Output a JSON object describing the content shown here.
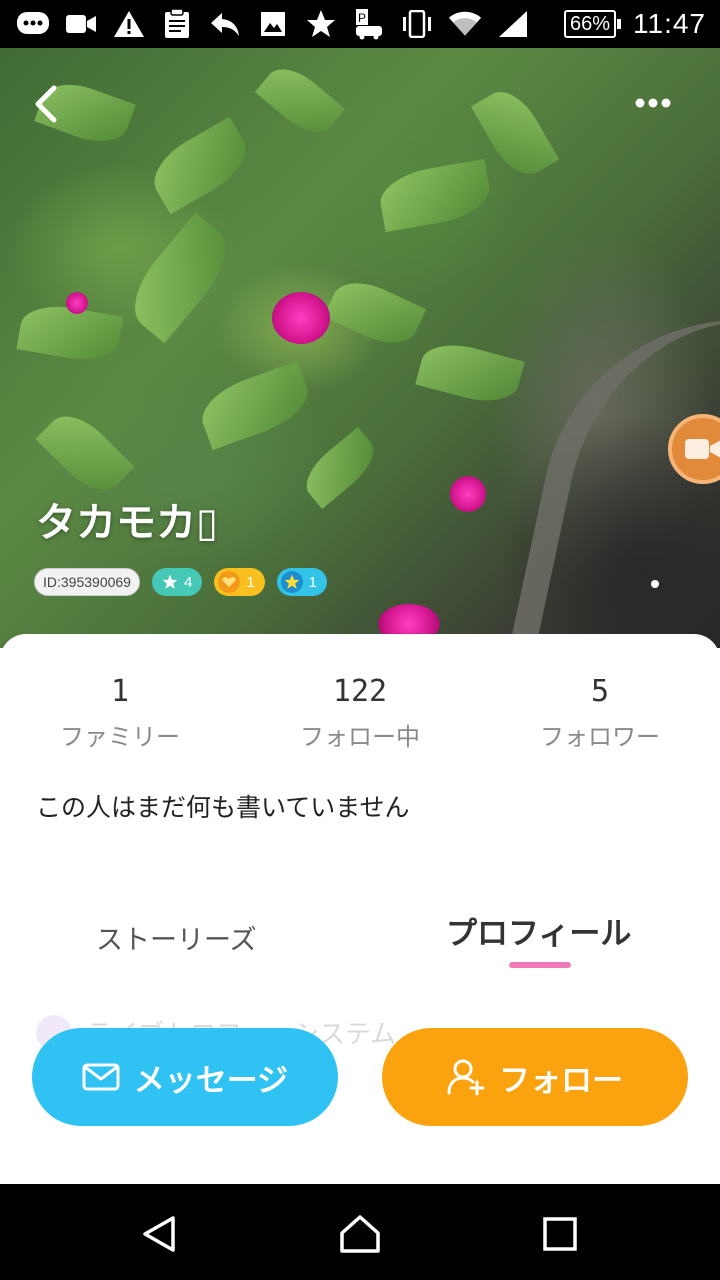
{
  "status_bar": {
    "icons": [
      "chat-bubble-icon",
      "video-camera-icon",
      "warning-icon",
      "clipboard-icon",
      "reply-icon",
      "image-icon",
      "star-icon",
      "parking-car-icon",
      "vibrate-icon",
      "wifi-icon",
      "signal-icon"
    ],
    "battery": "66%",
    "time": "11:47"
  },
  "header": {
    "back_icon": "chevron-left-icon",
    "more_icon": "more-dots-icon",
    "video_icon": "video-camera-icon"
  },
  "profile": {
    "name": "タカモカ▯",
    "id_badge": "ID:395390069",
    "badges": [
      {
        "icon": "star-icon",
        "count": "4",
        "color": "#45c9b6"
      },
      {
        "icon": "heart-icon",
        "count": "1",
        "color": "#f7c01e"
      },
      {
        "icon": "star-icon",
        "count": "1",
        "color": "#33c3e6"
      }
    ]
  },
  "stats": [
    {
      "value": "1",
      "label": "ファミリー"
    },
    {
      "value": "122",
      "label": "フォロー中"
    },
    {
      "value": "5",
      "label": "フォロワー"
    }
  ],
  "bio": "この人はまだ何も書いていません",
  "tabs": [
    {
      "label": "ストーリーズ",
      "active": false
    },
    {
      "label": "プロフィール",
      "active": true
    }
  ],
  "faded_row_text": "ライブトロフィーシステム",
  "actions": {
    "message_label": "メッセージ",
    "message_icon": "envelope-icon",
    "follow_label": "フォロー",
    "follow_icon": "add-user-icon"
  },
  "colors": {
    "message_button": "#30c2f2",
    "follow_button": "#fba30f",
    "tab_underline": "#f07ab8"
  },
  "nav_bar": {
    "icons": [
      "back-triangle-icon",
      "home-icon",
      "recents-square-icon"
    ]
  }
}
